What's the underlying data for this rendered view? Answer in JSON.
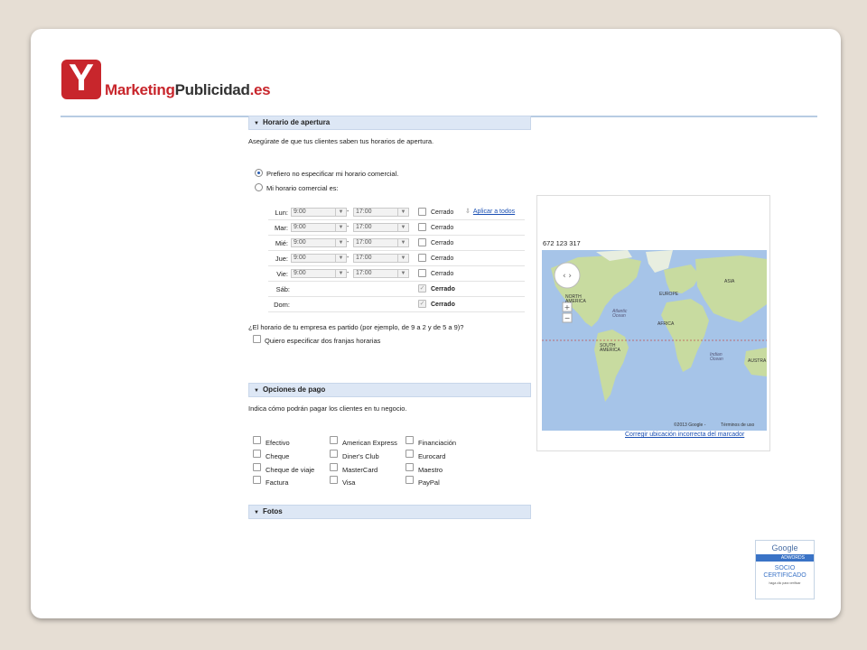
{
  "logo": {
    "letter": "Y",
    "text_a": "Marketing",
    "text_b": "Publicidad",
    "text_c": ".es"
  },
  "hours_section": {
    "header": "Horario de apertura",
    "intro": "Asegúrate de que tus clientes saben tus horarios de apertura.",
    "radio_1": "Prefiero no especificar mi horario comercial.",
    "radio_2": "Mi horario comercial es:",
    "apply_all": "Aplicar a todos",
    "closed": "Cerrado",
    "days": [
      {
        "day": "Lun:",
        "open": "9:00",
        "close": "17:00"
      },
      {
        "day": "Mar:",
        "open": "9:00",
        "close": "17:00"
      },
      {
        "day": "Mié:",
        "open": "9:00",
        "close": "17:00"
      },
      {
        "day": "Jue:",
        "open": "9:00",
        "close": "17:00"
      },
      {
        "day": "Vie:",
        "open": "9:00",
        "close": "17:00"
      },
      {
        "day": "Sáb:"
      },
      {
        "day": "Dom:"
      }
    ],
    "dash": "-",
    "split_question": "¿El horario de tu empresa es partido (por ejemplo, de 9 a 2 y de 5 a 9)?",
    "split_option": "Quiero especificar dos franjas horarias"
  },
  "map_panel": {
    "phone": "672 123 317",
    "labels": {
      "north_america": "NORTH AMERICA",
      "europe": "EUROPE",
      "asia": "ASIA",
      "africa": "AFRICA",
      "south_america": "SOUTH AMERICA",
      "atlantic": "Atlantic Ocean",
      "indian": "Indian Ocean",
      "australia": "AUSTRA"
    },
    "copyright": "©2013 Google -",
    "terms": "Términos de uso",
    "fix_link": "Corregir ubicación incorrecta del marcador"
  },
  "payment_section": {
    "header": "Opciones de pago",
    "intro": "Indica cómo podrán pagar los clientes en tu negocio.",
    "col1": [
      "Efectivo",
      "Cheque",
      "Cheque de viaje",
      "Factura"
    ],
    "col2": [
      "American Express",
      "Diner's Club",
      "MasterCard",
      "Visa"
    ],
    "col3": [
      "Financiación",
      "Eurocard",
      "Maestro",
      "PayPal"
    ]
  },
  "photos_section": {
    "header": "Fotos"
  },
  "badge": {
    "google": "Google",
    "adwords": "ADWORDS",
    "socio": "SOCIO",
    "certificado": "CERTIFICADO",
    "verify": "haga clic para verificar"
  },
  "colors": {
    "brand_red": "#c8262c",
    "link_blue": "#1a4fb3",
    "header_bg": "#dde7f5",
    "ocean": "#a6c4e8",
    "land": "#c8dba0"
  }
}
